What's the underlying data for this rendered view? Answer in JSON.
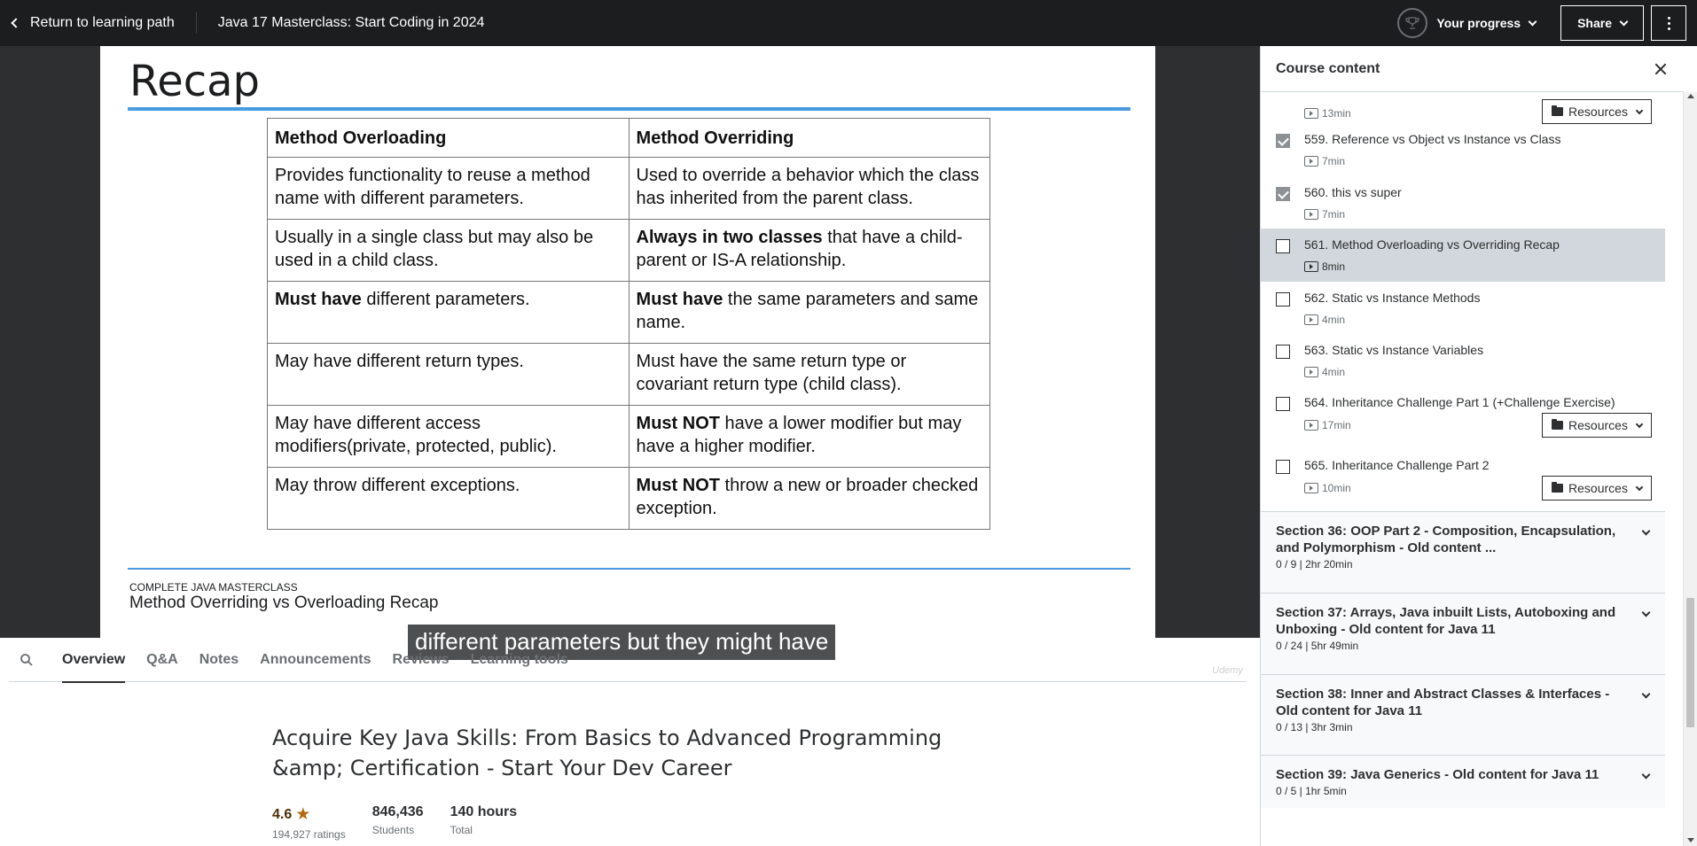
{
  "topbar": {
    "back_label": "Return to learning path",
    "course_title": "Java 17 Masterclass: Start Coding in 2024",
    "progress_label": "Your progress",
    "share_label": "Share"
  },
  "slide": {
    "title": "Recap",
    "table": {
      "headers": [
        "Method Overloading",
        "Method Overriding"
      ],
      "rows": [
        [
          {
            "bold": "",
            "text": "Provides functionality to reuse a method name with different parameters."
          },
          {
            "bold": "",
            "text": "Used to override a behavior which the class has inherited from the parent class."
          }
        ],
        [
          {
            "bold": "",
            "text": "Usually in a single class but may also be used in a child class."
          },
          {
            "bold": "Always in two classes",
            "text": " that have a child-parent or IS-A relationship."
          }
        ],
        [
          {
            "bold": "Must have",
            "text": " different parameters."
          },
          {
            "bold": "Must have",
            "text": " the same parameters and same name."
          }
        ],
        [
          {
            "bold": "",
            "text": "May have different return types."
          },
          {
            "bold": "",
            "text": "Must have the same return type or covariant return type (child class)."
          }
        ],
        [
          {
            "bold": "",
            "text": "May have different access modifiers(private, protected, public)."
          },
          {
            "bold": "Must NOT",
            "text": " have a lower modifier but may have a higher modifier."
          }
        ],
        [
          {
            "bold": "",
            "text": "May throw different exceptions."
          },
          {
            "bold": "Must NOT",
            "text": " throw a new or broader checked exception."
          }
        ]
      ]
    },
    "footer_small": "COMPLETE JAVA MASTERCLASS",
    "footer_big": "Method Overriding vs Overloading Recap",
    "caption": "different parameters but they might have",
    "watermark": "Udemy"
  },
  "tabs": [
    {
      "label": "Overview",
      "active": true
    },
    {
      "label": "Q&A",
      "active": false
    },
    {
      "label": "Notes",
      "active": false
    },
    {
      "label": "Announcements",
      "active": false
    },
    {
      "label": "Reviews",
      "active": false
    },
    {
      "label": "Learning tools",
      "active": false
    }
  ],
  "overview": {
    "headline": "Acquire Key Java Skills: From Basics to Advanced Programming &amp; Certification - Start Your Dev Career",
    "rating": "4.6",
    "ratings_count": "194,927 ratings",
    "students": "846,436",
    "students_label": "Students",
    "hours": "140 hours",
    "hours_label": "Total"
  },
  "sidebar": {
    "title": "Course content",
    "resources_label": "Resources",
    "partial_lecture_duration": "13min",
    "lectures": [
      {
        "title": "559. Reference vs Object vs Instance vs Class",
        "duration": "7min",
        "done": true,
        "current": false,
        "resources": false
      },
      {
        "title": "560. this vs super",
        "duration": "7min",
        "done": true,
        "current": false,
        "resources": false
      },
      {
        "title": "561. Method Overloading vs Overriding Recap",
        "duration": "8min",
        "done": false,
        "current": true,
        "resources": false
      },
      {
        "title": "562. Static vs Instance Methods",
        "duration": "4min",
        "done": false,
        "current": false,
        "resources": false
      },
      {
        "title": "563. Static vs Instance Variables",
        "duration": "4min",
        "done": false,
        "current": false,
        "resources": false
      },
      {
        "title": "564. Inheritance Challenge Part 1 (+Challenge Exercise)",
        "duration": "17min",
        "done": false,
        "current": false,
        "resources": true
      },
      {
        "title": "565. Inheritance Challenge Part 2",
        "duration": "10min",
        "done": false,
        "current": false,
        "resources": true
      }
    ],
    "sections": [
      {
        "title": "Section 36: OOP Part 2 - Composition, Encapsulation, and Polymorphism - Old content ...",
        "meta": "0 / 9 | 2hr 20min"
      },
      {
        "title": "Section 37: Arrays, Java inbuilt Lists, Autoboxing and Unboxing - Old content for Java 11",
        "meta": "0 / 24 | 5hr 49min"
      },
      {
        "title": "Section 38: Inner and Abstract Classes & Interfaces - Old content for Java 11",
        "meta": "0 / 13 | 3hr 3min"
      },
      {
        "title": "Section 39: Java Generics - Old content for Java 11",
        "meta": "0 / 5 | 1hr 5min"
      }
    ]
  }
}
